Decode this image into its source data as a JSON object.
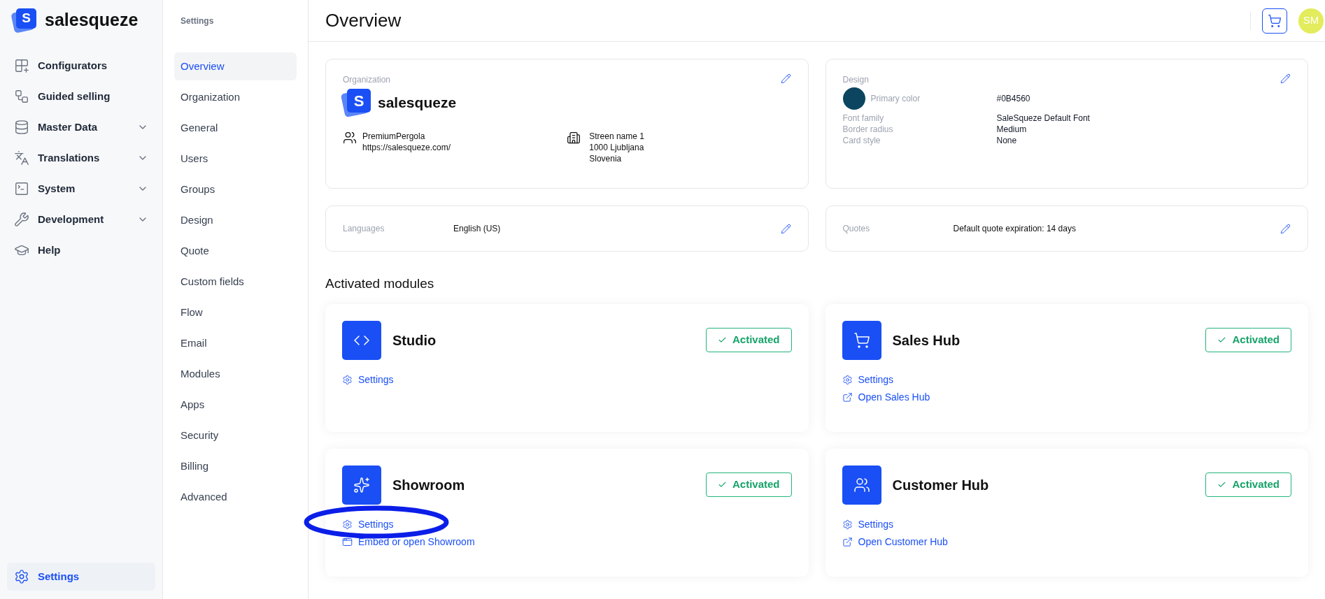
{
  "brand": {
    "logo_letter": "S",
    "name": "salesqueze"
  },
  "nav": {
    "items": [
      {
        "label": "Configurators",
        "kind": "link",
        "selected": false
      },
      {
        "label": "Guided selling",
        "kind": "link",
        "selected": false
      },
      {
        "label": "Master Data",
        "kind": "group",
        "selected": false
      },
      {
        "label": "Translations",
        "kind": "group",
        "selected": false
      },
      {
        "label": "System",
        "kind": "group",
        "selected": false
      },
      {
        "label": "Development",
        "kind": "group",
        "selected": false
      },
      {
        "label": "Help",
        "kind": "link",
        "selected": false
      }
    ],
    "bottom": {
      "label": "Settings",
      "selected": true
    }
  },
  "settings_nav": {
    "title": "Settings",
    "items": [
      {
        "label": "Overview",
        "selected": true
      },
      {
        "label": "Organization",
        "selected": false
      },
      {
        "label": "General",
        "selected": false
      },
      {
        "label": "Users",
        "selected": false
      },
      {
        "label": "Groups",
        "selected": false
      },
      {
        "label": "Design",
        "selected": false
      },
      {
        "label": "Quote",
        "selected": false
      },
      {
        "label": "Custom fields",
        "selected": false
      },
      {
        "label": "Flow",
        "selected": false
      },
      {
        "label": "Email",
        "selected": false
      },
      {
        "label": "Modules",
        "selected": false
      },
      {
        "label": "Apps",
        "selected": false
      },
      {
        "label": "Security",
        "selected": false
      },
      {
        "label": "Billing",
        "selected": false
      },
      {
        "label": "Advanced",
        "selected": false
      }
    ]
  },
  "header": {
    "title": "Overview",
    "avatar_initials": "SM"
  },
  "organization": {
    "label": "Organization",
    "logo_letter": "S",
    "brand_name": "salesqueze",
    "company": [
      "PremiumPergola",
      "https://salesqueze.com/"
    ],
    "address": [
      "Streen name 1",
      "1000 Ljubljana",
      "Slovenia"
    ]
  },
  "design": {
    "label": "Design",
    "primary": {
      "label": "Primary color",
      "value": "#0B4560",
      "color": "#0b4560"
    },
    "rows": [
      {
        "label": "Font family",
        "value": "SaleSqueze Default Font"
      },
      {
        "label": "Border radius",
        "value": "Medium"
      },
      {
        "label": "Card style",
        "value": "None"
      }
    ]
  },
  "languages": {
    "label": "Languages",
    "value": "English (US)"
  },
  "quotes": {
    "label": "Quotes",
    "value": "Default quote expiration: 14 days"
  },
  "modules": {
    "title": "Activated modules",
    "items": [
      {
        "name": "Studio",
        "status": "Activated",
        "links": [
          {
            "label": "Settings",
            "kind": "settings",
            "highlighted": false
          }
        ]
      },
      {
        "name": "Sales Hub",
        "status": "Activated",
        "links": [
          {
            "label": "Settings",
            "kind": "settings",
            "highlighted": false
          },
          {
            "label": "Open Sales Hub",
            "kind": "open",
            "highlighted": false
          }
        ]
      },
      {
        "name": "Showroom",
        "status": "Activated",
        "links": [
          {
            "label": "Settings",
            "kind": "settings",
            "highlighted": true
          },
          {
            "label": "Embed or open Showroom",
            "kind": "embed",
            "highlighted": false
          }
        ]
      },
      {
        "name": "Customer Hub",
        "status": "Activated",
        "links": [
          {
            "label": "Settings",
            "kind": "settings",
            "highlighted": false
          },
          {
            "label": "Open Customer Hub",
            "kind": "open",
            "highlighted": false
          }
        ]
      }
    ]
  }
}
